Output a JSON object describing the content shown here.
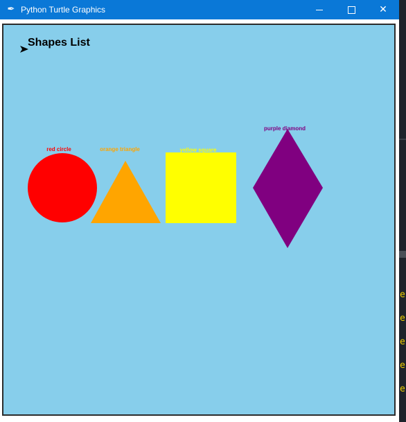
{
  "window": {
    "title": "Python Turtle Graphics",
    "icon": "feather-icon",
    "controls": [
      "minimize-icon",
      "maximize-icon",
      "close-icon"
    ]
  },
  "canvas": {
    "background": "#87ceeb",
    "heading": "Shapes List",
    "shapes": [
      {
        "label": "red circle",
        "color": "#ff0000",
        "shape": "circle"
      },
      {
        "label": "orange triangle",
        "color": "#ffa500",
        "shape": "triangle"
      },
      {
        "label": "yellow square",
        "color": "#ffff00",
        "shape": "square"
      },
      {
        "label": "purple diamond",
        "color": "#800080",
        "shape": "diamond"
      }
    ]
  },
  "side_panel": {
    "letters": [
      "e",
      "e",
      "e",
      "e",
      "e"
    ],
    "letter_color": "#f0d000"
  }
}
